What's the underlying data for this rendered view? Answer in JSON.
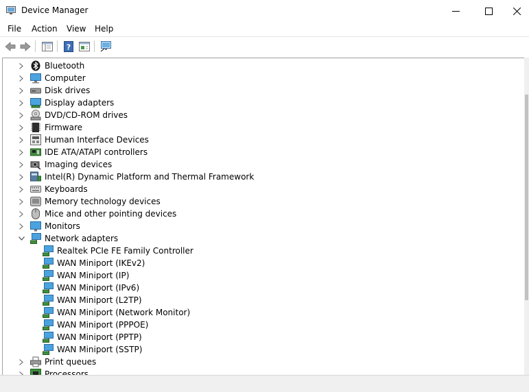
{
  "window": {
    "title": "Device Manager"
  },
  "menu": [
    "File",
    "Action",
    "View",
    "Help"
  ],
  "toolbar": [
    {
      "name": "back-button",
      "icon": "back-arrow-icon"
    },
    {
      "name": "forward-button",
      "icon": "forward-arrow-icon"
    },
    {
      "name": "show-hide-console-tree-button",
      "icon": "console-tree-icon"
    },
    {
      "name": "help-button",
      "icon": "help-icon"
    },
    {
      "name": "properties-button",
      "icon": "properties-icon"
    },
    {
      "name": "scan-hardware-button",
      "icon": "monitor-scan-icon"
    }
  ],
  "tree": [
    {
      "label": "Bluetooth",
      "level": 0,
      "expanded": false,
      "icon": "bluetooth-icon"
    },
    {
      "label": "Computer",
      "level": 0,
      "expanded": false,
      "icon": "computer-icon"
    },
    {
      "label": "Disk drives",
      "level": 0,
      "expanded": false,
      "icon": "disk-drive-icon"
    },
    {
      "label": "Display adapters",
      "level": 0,
      "expanded": false,
      "icon": "display-adapter-icon"
    },
    {
      "label": "DVD/CD-ROM drives",
      "level": 0,
      "expanded": false,
      "icon": "dvd-drive-icon"
    },
    {
      "label": "Firmware",
      "level": 0,
      "expanded": false,
      "icon": "firmware-icon"
    },
    {
      "label": "Human Interface Devices",
      "level": 0,
      "expanded": false,
      "icon": "hid-icon"
    },
    {
      "label": "IDE ATA/ATAPI controllers",
      "level": 0,
      "expanded": false,
      "icon": "ide-controller-icon"
    },
    {
      "label": "Imaging devices",
      "level": 0,
      "expanded": false,
      "icon": "camera-icon"
    },
    {
      "label": "Intel(R) Dynamic Platform and Thermal Framework",
      "level": 0,
      "expanded": false,
      "icon": "system-device-icon"
    },
    {
      "label": "Keyboards",
      "level": 0,
      "expanded": false,
      "icon": "keyboard-icon"
    },
    {
      "label": "Memory technology devices",
      "level": 0,
      "expanded": false,
      "icon": "memory-icon"
    },
    {
      "label": "Mice and other pointing devices",
      "level": 0,
      "expanded": false,
      "icon": "mouse-icon"
    },
    {
      "label": "Monitors",
      "level": 0,
      "expanded": false,
      "icon": "monitor-icon"
    },
    {
      "label": "Network adapters",
      "level": 0,
      "expanded": true,
      "icon": "network-adapter-icon"
    },
    {
      "label": "Realtek PCIe FE Family Controller",
      "level": 1,
      "icon": "network-adapter-icon"
    },
    {
      "label": "WAN Miniport (IKEv2)",
      "level": 1,
      "icon": "network-adapter-icon"
    },
    {
      "label": "WAN Miniport (IP)",
      "level": 1,
      "icon": "network-adapter-icon"
    },
    {
      "label": "WAN Miniport (IPv6)",
      "level": 1,
      "icon": "network-adapter-icon"
    },
    {
      "label": "WAN Miniport (L2TP)",
      "level": 1,
      "icon": "network-adapter-icon"
    },
    {
      "label": "WAN Miniport (Network Monitor)",
      "level": 1,
      "icon": "network-adapter-icon"
    },
    {
      "label": "WAN Miniport (PPPOE)",
      "level": 1,
      "icon": "network-adapter-icon"
    },
    {
      "label": "WAN Miniport (PPTP)",
      "level": 1,
      "icon": "network-adapter-icon"
    },
    {
      "label": "WAN Miniport (SSTP)",
      "level": 1,
      "icon": "network-adapter-icon"
    },
    {
      "label": "Print queues",
      "level": 0,
      "expanded": false,
      "icon": "printer-icon"
    },
    {
      "label": "Processors",
      "level": 0,
      "expanded": false,
      "icon": "processor-icon"
    }
  ]
}
